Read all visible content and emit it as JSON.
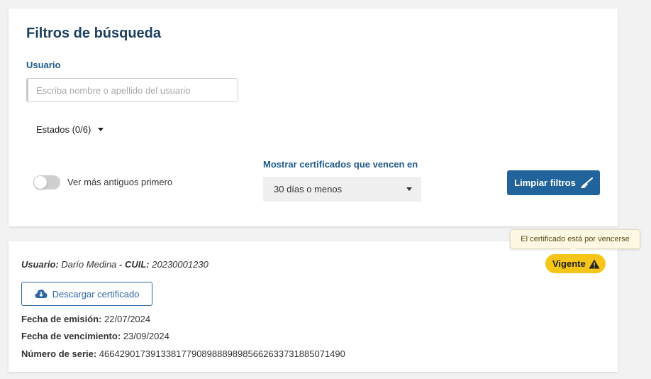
{
  "filters": {
    "title": "Filtros de búsqueda",
    "user_label": "Usuario",
    "user_placeholder": "Escriba nombre o apellido del usuario",
    "user_value": "",
    "estados_label": "Estados (0/6)",
    "toggle_label": "Ver más antiguos primero",
    "toggle_on": false,
    "expire_label": "Mostrar certificados que vencen en",
    "expire_selected": "30 días o menos",
    "clear_button": "Limpiar filtros"
  },
  "certificate": {
    "user_key": "Usuario:",
    "user_name": "Darío Medina",
    "separator": " - ",
    "cuil_key": "CUIL:",
    "cuil": "20230001230",
    "status_badge": "Vigente",
    "tooltip": "El certificado está por vencerse",
    "download_button": "Descargar certificado",
    "emision_key": "Fecha de emisión:",
    "emision": "22/07/2024",
    "vencimiento_key": "Fecha de vencimiento:",
    "vencimiento": "23/09/2024",
    "serie_key": "Número de serie:",
    "serie": "466429017391338177908988898985662633731885071490"
  },
  "colors": {
    "accent": "#21649c",
    "title": "#1b3f5e",
    "badge": "#f5c518",
    "tooltip_bg": "#fcf8e3"
  },
  "icons": {
    "caret": "caret-down-icon",
    "broom": "broom-icon",
    "warning": "warning-icon",
    "download": "cloud-download-icon"
  }
}
